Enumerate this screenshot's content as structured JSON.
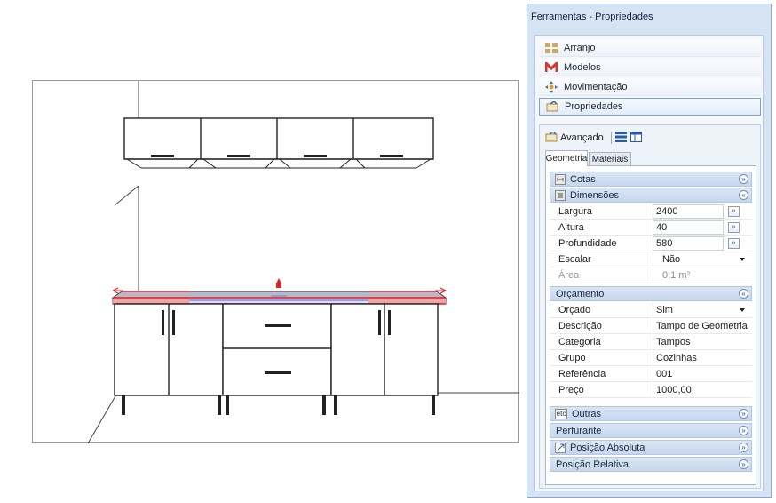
{
  "panel": {
    "title": "Ferramentas - Propriedades",
    "nav": [
      {
        "label": "Arranjo",
        "icon": "grid-icon"
      },
      {
        "label": "Modelos",
        "icon": "models-icon"
      },
      {
        "label": "Movimentação",
        "icon": "move-icon"
      },
      {
        "label": "Propriedades",
        "icon": "properties-icon",
        "active": true
      }
    ],
    "advanced_label": "Avançado",
    "tabs": {
      "geometry": "Geometria",
      "materials": "Materiais"
    },
    "sections": {
      "cotas": "Cotas",
      "dimensoes": "Dimensões",
      "orcamento": "Orçamento",
      "outras": "Outras",
      "perfurante": "Perfurante",
      "posicao_absoluta": "Posição Absoluta",
      "posicao_relativa": "Posição Relativa"
    },
    "dimensions": [
      {
        "key": "Largura",
        "value": "2400",
        "more": "»"
      },
      {
        "key": "Altura",
        "value": "40",
        "more": "»"
      },
      {
        "key": "Profundidade",
        "value": "580",
        "more": "»"
      },
      {
        "key": "Escalar",
        "value": "Não"
      },
      {
        "key": "Área",
        "value": "0,1 m²"
      }
    ],
    "budget": [
      {
        "key": "Orçado",
        "value": "Sim"
      },
      {
        "key": "Descrição",
        "value": "Tampo de Geometria"
      },
      {
        "key": "Categoria",
        "value": "Tampos"
      },
      {
        "key": "Grupo",
        "value": "Cozinhas"
      },
      {
        "key": "Referência",
        "value": "001"
      },
      {
        "key": "Preço",
        "value": "1000,00"
      }
    ],
    "outras_icon_text": "etc"
  },
  "colors": {
    "panel_bg": "#d6e3f2",
    "section_header": "#c6d7ee",
    "selection_red": "#e0202a",
    "selection_blue": "#7a7ae0"
  }
}
